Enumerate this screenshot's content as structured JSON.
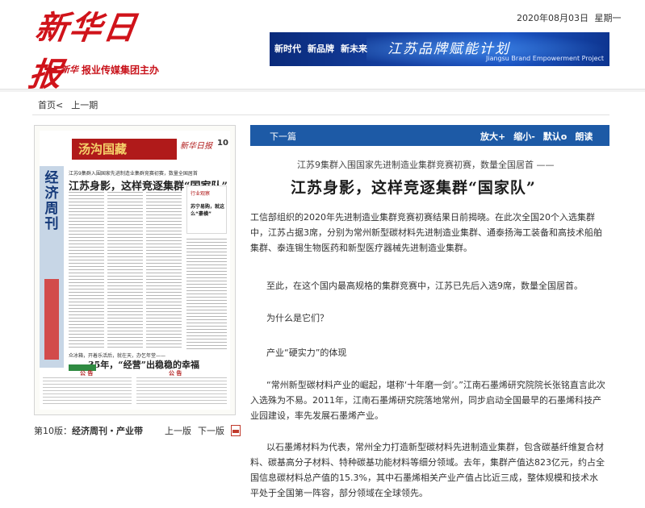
{
  "header": {
    "logo_text": "新华日报",
    "sponsor_logo": "新华",
    "sponsor_text": "报业传媒集团主办",
    "date": "2020年08月03日",
    "weekday": "星期一"
  },
  "banner": {
    "slogans": [
      "新时代",
      "新品牌",
      "新未来"
    ],
    "title": "江苏品牌赋能计划",
    "subtitle": "Jiangsu Brand Empowerment Project"
  },
  "breadcrumb": {
    "home": "首页",
    "home_arrow": "<",
    "prev": "上一期"
  },
  "paper_thumbnail": {
    "ad_title": "汤沟国藏",
    "masthead": "新华日报",
    "page_number": "10",
    "side_title": "经济周刊",
    "sub_headline": "江苏9集群入围国家先进制造业集群竞赛初赛，数量全国居首",
    "headline": "江苏身影，这样竞逐集群“国家队”",
    "right_box_top": "行业观察",
    "right_box_title": "苏宁易购，就这么“豪横”",
    "band_text": "众冰箱，开着乐活后，就在天，办乞年堂——",
    "headline2": "35年，“经营”出稳稳的幸福",
    "notice_left": "公  告",
    "notice_right": "公  告"
  },
  "edition": {
    "label": "第10版：",
    "name": "经济周刊・产业带",
    "prev_page": "上一版",
    "next_page": "下一版"
  },
  "toolbar": {
    "next_article": "下一篇",
    "zoom_in": "放大+",
    "zoom_out": "缩小-",
    "default": "默认o",
    "read_aloud": "朗读"
  },
  "article": {
    "subtitle": "江苏9集群入围国家先进制造业集群竞赛初赛，数量全国居首  ——",
    "title": "江苏身影，这样竞逐集群“国家队”",
    "paragraphs": [
      "工信部组织的2020年先进制造业集群竞赛初赛结果日前揭晓。在此次全国20个入选集群中，江苏占据3席，分别为常州新型碳材料先进制造业集群、通泰扬海工装备和高技术船舶集群、泰连锡生物医药和新型医疗器械先进制造业集群。",
      "至此，在这个国内最高规格的集群竞赛中，江苏已先后入选9席，数量全国居首。",
      "为什么是它们？",
      "产业“硬实力”的体现",
      "“常州新型碳材料产业的崛起，堪称‘十年磨一剑’。”江南石墨烯研究院院长张铭直言此次入选殊为不易。2011年，江南石墨烯研究院落地常州，同步启动全国最早的石墨烯科技产业园建设，率先发展石墨烯产业。",
      "以石墨烯材料为代表，常州全力打造新型碳材料先进制造业集群，包含碳基纤维复合材料、碳基高分子材料、特种碳基功能材料等细分领域。去年，集群产值达823亿元，约占全国信息碳材料总产值的15.3%，其中石墨烯相关产业产值占比近三成，整体规模和技术水平处于全国第一阵容，部分领域在全球领先。"
    ]
  }
}
